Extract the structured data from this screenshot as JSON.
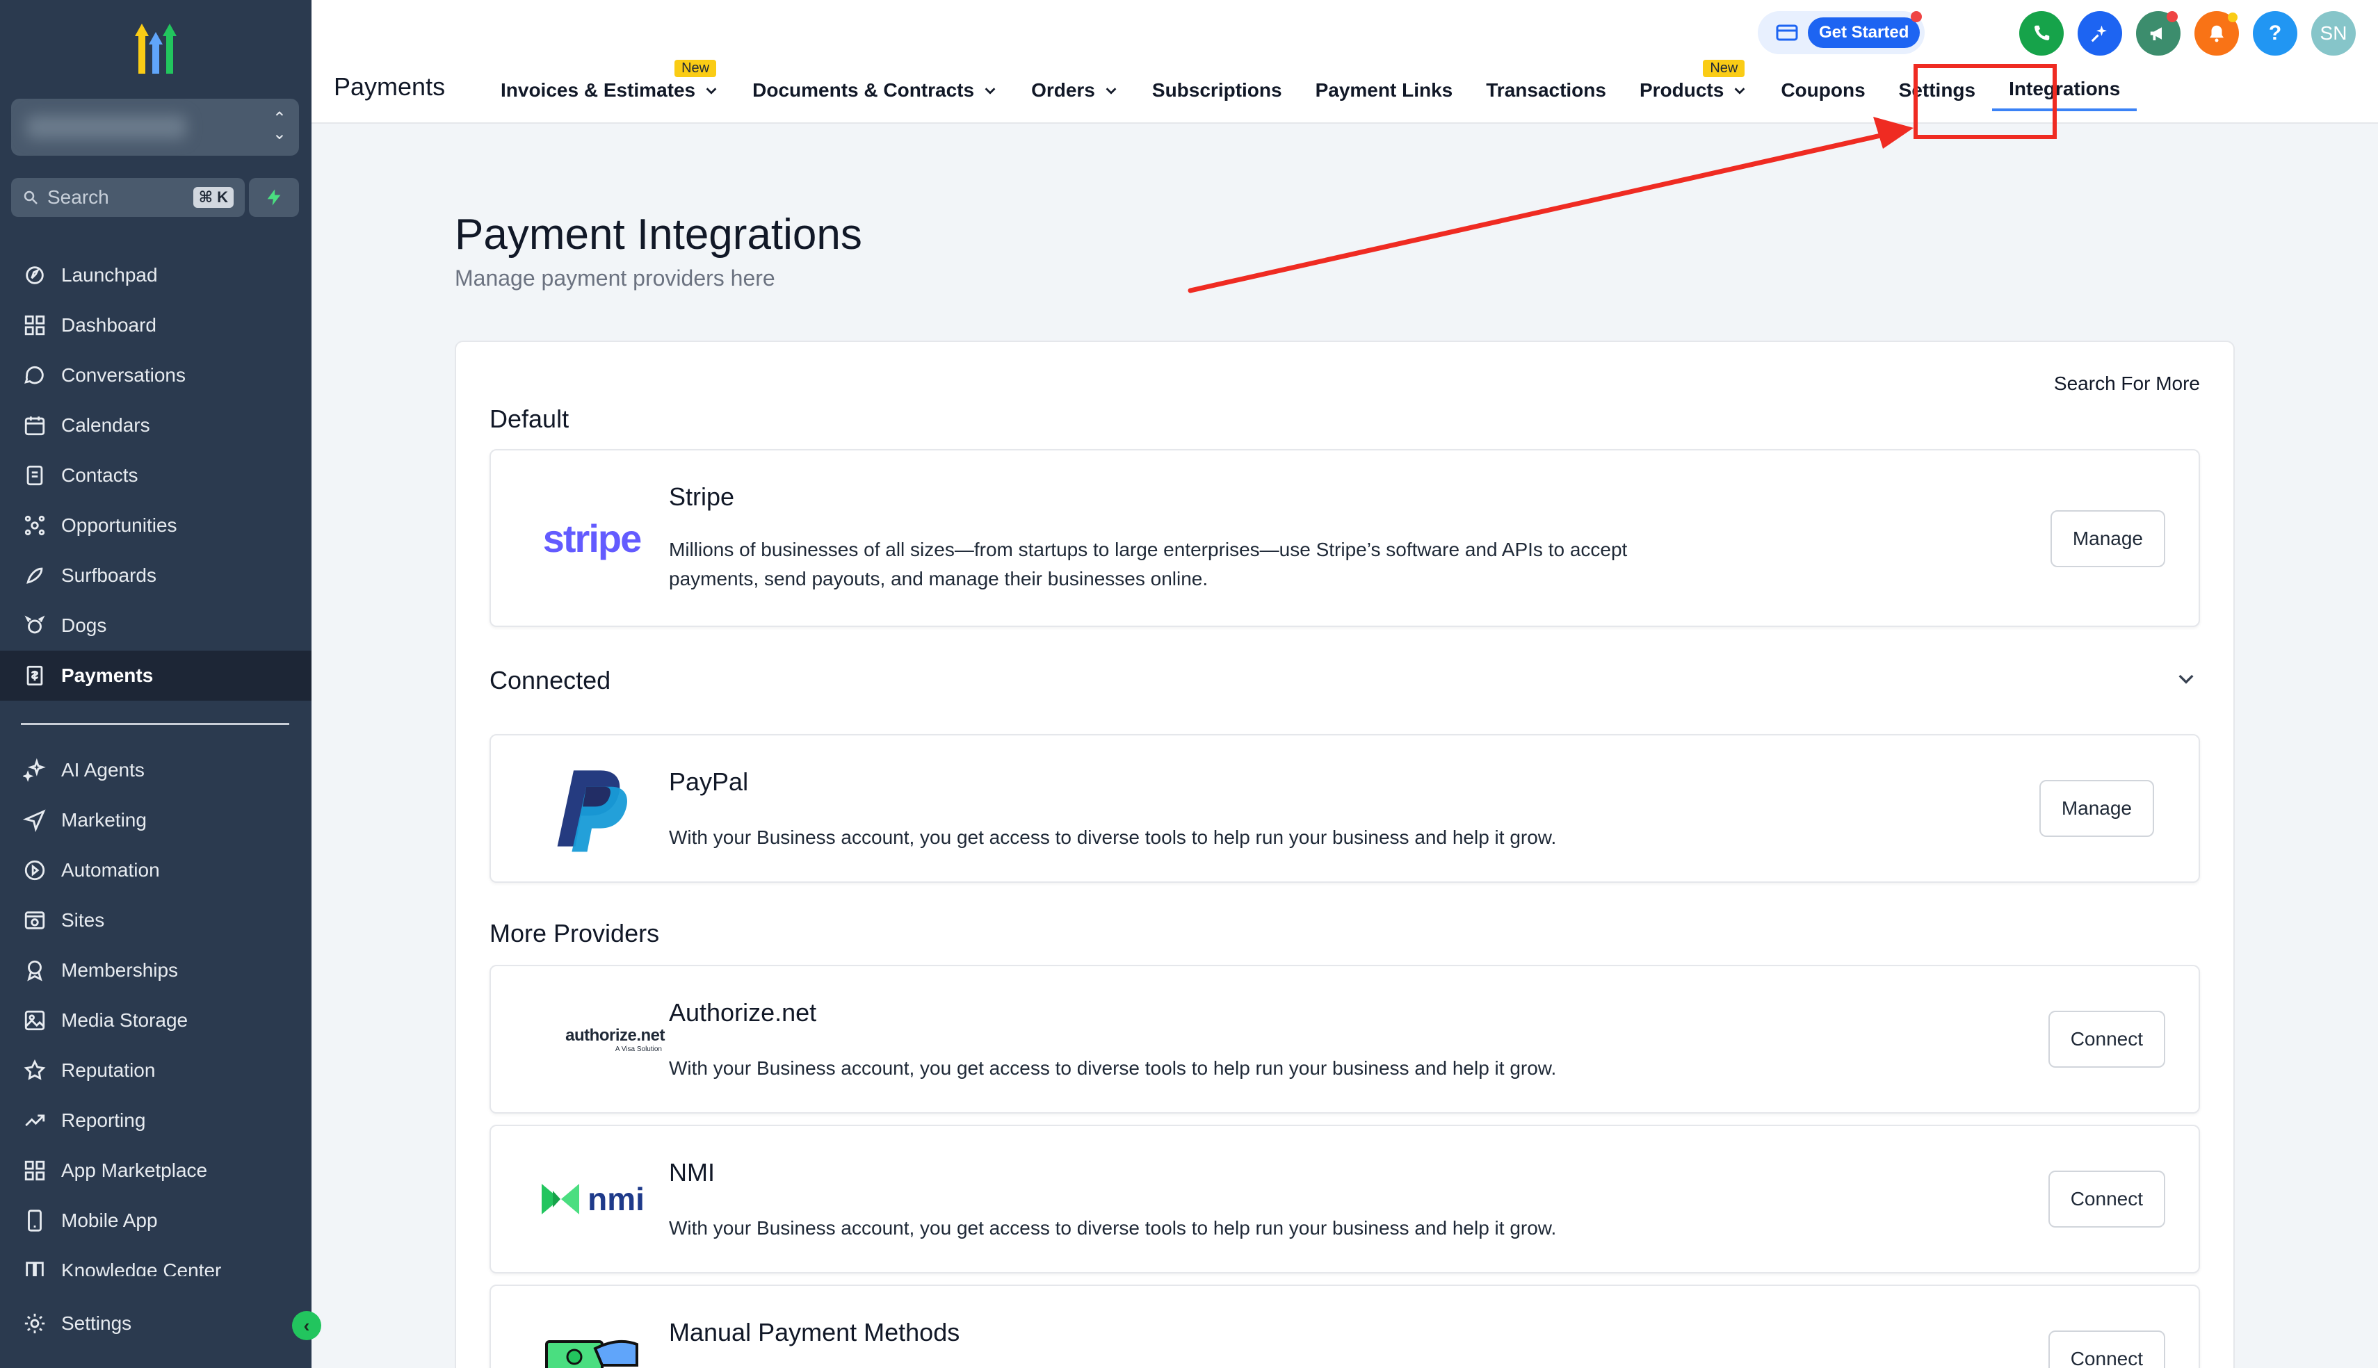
{
  "sidebar": {
    "search_label": "Search",
    "search_shortcut": "⌘ K",
    "items": [
      {
        "label": "Launchpad",
        "icon": "launchpad-icon"
      },
      {
        "label": "Dashboard",
        "icon": "dashboard-icon"
      },
      {
        "label": "Conversations",
        "icon": "chat-icon"
      },
      {
        "label": "Calendars",
        "icon": "calendar-icon"
      },
      {
        "label": "Contacts",
        "icon": "contacts-icon"
      },
      {
        "label": "Opportunities",
        "icon": "opportunities-icon"
      },
      {
        "label": "Surfboards",
        "icon": "surfboard-icon"
      },
      {
        "label": "Dogs",
        "icon": "dog-icon"
      },
      {
        "label": "Payments",
        "icon": "payments-icon",
        "active": true
      }
    ],
    "items2": [
      {
        "label": "AI Agents",
        "icon": "sparkle-icon"
      },
      {
        "label": "Marketing",
        "icon": "send-icon"
      },
      {
        "label": "Automation",
        "icon": "automation-icon"
      },
      {
        "label": "Sites",
        "icon": "sites-icon"
      },
      {
        "label": "Memberships",
        "icon": "membership-icon"
      },
      {
        "label": "Media Storage",
        "icon": "image-icon"
      },
      {
        "label": "Reputation",
        "icon": "star-icon"
      },
      {
        "label": "Reporting",
        "icon": "trend-icon"
      },
      {
        "label": "App Marketplace",
        "icon": "grid-icon"
      },
      {
        "label": "Mobile App",
        "icon": "mobile-icon"
      },
      {
        "label": "Knowledge Center",
        "icon": "book-icon"
      }
    ],
    "settings_label": "Settings"
  },
  "topbar": {
    "title": "Payments",
    "tabs": [
      {
        "label": "Invoices & Estimates",
        "badge": "New",
        "dropdown": true
      },
      {
        "label": "Documents & Contracts",
        "dropdown": true
      },
      {
        "label": "Orders",
        "dropdown": true
      },
      {
        "label": "Subscriptions"
      },
      {
        "label": "Payment Links"
      },
      {
        "label": "Transactions"
      },
      {
        "label": "Products",
        "badge": "New",
        "dropdown": true
      },
      {
        "label": "Coupons"
      },
      {
        "label": "Settings"
      },
      {
        "label": "Integrations",
        "active": true
      }
    ],
    "get_started": "Get Started",
    "avatar_initials": "SN",
    "help": "?"
  },
  "main": {
    "title": "Payment Integrations",
    "subtitle": "Manage payment providers here",
    "search_more": "Search For More",
    "sections": {
      "default": "Default",
      "connected": "Connected",
      "more": "More Providers"
    },
    "stripe": {
      "logo_text": "stripe",
      "name": "Stripe",
      "desc": "Millions of businesses of all sizes—from startups to large enterprises—use Stripe’s software and APIs to accept payments, send payouts, and manage their businesses online.",
      "button": "Manage"
    },
    "paypal": {
      "name": "PayPal",
      "desc": "With your Business account, you get access to diverse tools to help run your business and help it grow.",
      "button": "Manage"
    },
    "authorize": {
      "logo_text": "authorize.net",
      "logo_sub": "A Visa Solution",
      "name": "Authorize.net",
      "desc": "With your Business account, you get access to diverse tools to help run your business and help it grow.",
      "button": "Connect"
    },
    "nmi": {
      "logo_text": "nmi",
      "name": "NMI",
      "desc": "With your Business account, you get access to diverse tools to help run your business and help it grow.",
      "button": "Connect"
    },
    "manual": {
      "name": "Manual Payment Methods",
      "button": "Connect"
    }
  },
  "colors": {
    "sidebar_bg": "#2b3a4f",
    "accent_blue": "#1d64f2",
    "annotation_red": "#ef2b22",
    "stripe_purple": "#635bff",
    "paypal_dark": "#253b80",
    "paypal_light": "#179bd7"
  }
}
